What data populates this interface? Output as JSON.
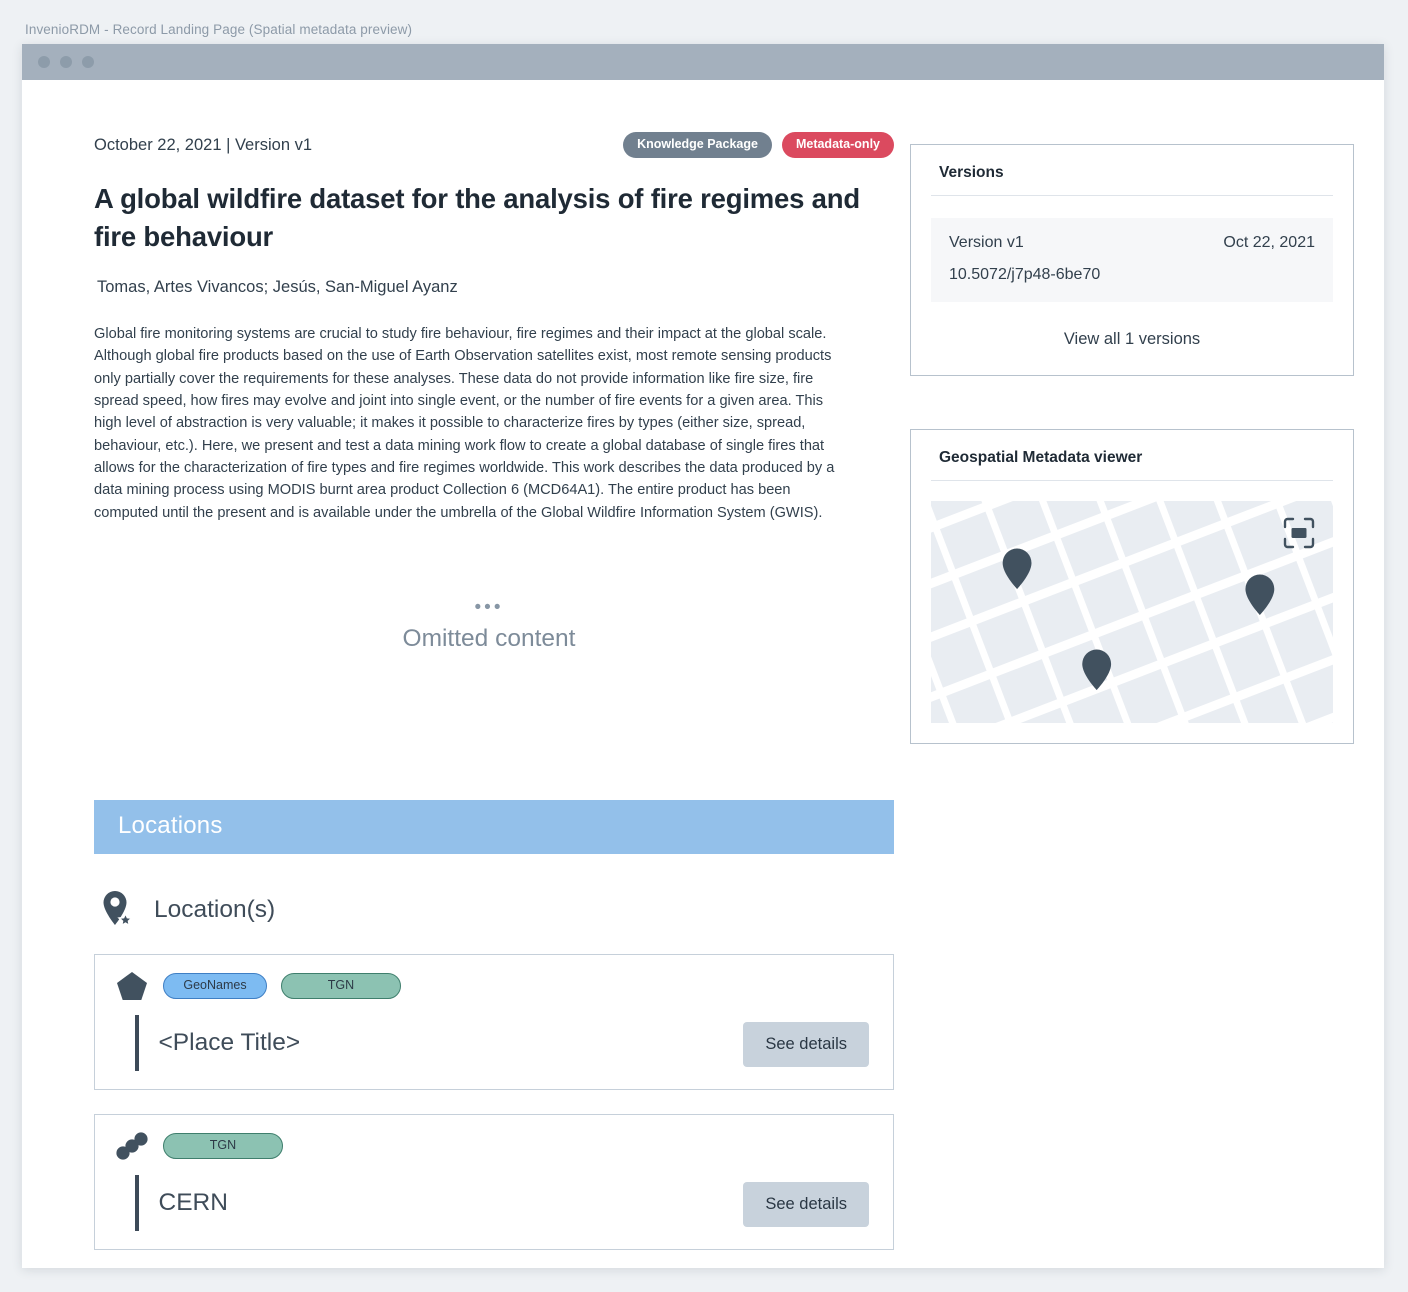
{
  "window": {
    "caption": "InvenioRDM - Record Landing Page (Spatial metadata preview)"
  },
  "record": {
    "date_version": "October 22, 2021 | Version v1",
    "badges": [
      {
        "label": "Knowledge Package",
        "style": "grey",
        "color": "#71808f"
      },
      {
        "label": "Metadata-only",
        "style": "red",
        "color": "#db4a5f"
      }
    ],
    "title": "A global wildfire dataset for the analysis of fire regimes and fire behaviour",
    "creators": "Tomas, Artes Vivancos; Jesús, San-Miguel Ayanz",
    "abstract": "Global fire monitoring systems are crucial to study fire behaviour, fire regimes and their impact at the global scale. Although global fire products based on the use of Earth Observation satellites exist, most remote sensing products only partially cover the requirements for these analyses. These data do not provide information like fire size, fire spread speed, how fires may evolve and joint into single event, or the number of fire events for a given area. This high level of abstraction is very valuable; it makes it possible to characterize fires by types (either size, spread, behaviour, etc.). Here, we present and test a data mining work flow to create a global database of single fires that allows for the characterization of fire types and fire regimes worldwide. This work describes the data produced by a data mining process using MODIS burnt area product Collection 6 (MCD64A1). The entire product has been computed until the present and is available under the umbrella of the Global Wildfire Information System (GWIS).",
    "omitted": {
      "ellipsis": "•••",
      "label": "Omitted content"
    }
  },
  "versions_panel": {
    "heading": "Versions",
    "entry": {
      "label": "Version v1",
      "date": "Oct 22, 2021",
      "doi": "10.5072/j7p48-6be70"
    },
    "view_all": "View all 1 versions"
  },
  "geospatial_panel": {
    "heading": "Geospatial Metadata viewer",
    "focus_icon": "center-map-icon",
    "pin_count": 3,
    "map_colors": {
      "land": "#e9edf2",
      "street": "#ffffff",
      "pin": "#41515f"
    }
  },
  "locations": {
    "banner": "Locations",
    "section_icon": "map-pin-star-icon",
    "section_label": "Location(s)",
    "items": [
      {
        "geometry_icon": "polygon-icon",
        "identifiers": [
          {
            "label": "GeoNames",
            "scheme": "geonames",
            "color": "#7dbbf2"
          },
          {
            "label": "TGN",
            "scheme": "tgn",
            "color": "#8cc2b2"
          }
        ],
        "name": "<Place Title>",
        "action": "See details"
      },
      {
        "geometry_icon": "multipoint-icon",
        "identifiers": [
          {
            "label": "TGN",
            "scheme": "tgn",
            "color": "#8cc2b2"
          }
        ],
        "name": "CERN",
        "action": "See details"
      }
    ]
  }
}
